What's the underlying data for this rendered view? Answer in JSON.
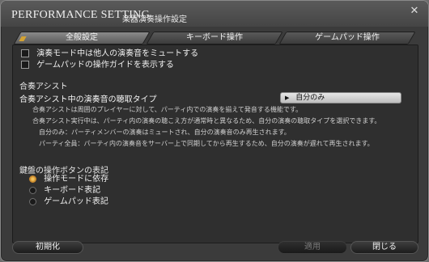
{
  "window": {
    "title": "PERFORMANCE SETTING",
    "subtitle": "楽器演奏操作設定",
    "close_icon": "close-icon"
  },
  "tabs": [
    {
      "label": "全般設定",
      "active": true
    },
    {
      "label": "キーボード操作",
      "active": false
    },
    {
      "label": "ゲームパッド操作",
      "active": false
    }
  ],
  "checkboxes": [
    {
      "label": "演奏モード中は他人の演奏音をミュートする",
      "checked": false
    },
    {
      "label": "ゲームパッドの操作ガイドを表示する",
      "checked": false
    }
  ],
  "ensemble": {
    "section_title": "合奏アシスト",
    "setting_label": "合奏アシスト中の演奏音の聴取タイプ",
    "dropdown_value": "自分のみ",
    "descriptions": [
      "合奏アシストは周囲のプレイヤーに対して、パーティ内での演奏を揃えて発音する機能です。",
      "合奏アシスト実行中は、パーティ内の演奏の聴こえ方が通常時と異なるため、自分の演奏の聴取タイプを選択できます。",
      "自分のみ：パーティメンバーの演奏はミュートされ、自分の演奏音のみ再生されます。",
      "パーティ全員：パーティ内の演奏音をサーバー上で同期してから再生するため、自分の演奏が遅れて再生されます。"
    ]
  },
  "keyboard_binding": {
    "section_title": "鍵盤の操作ボタンの表記",
    "options": [
      {
        "label": "操作モードに依存",
        "selected": true
      },
      {
        "label": "キーボード表記",
        "selected": false
      },
      {
        "label": "ゲームパッド表記",
        "selected": false
      }
    ]
  },
  "buttons": {
    "reset": "初期化",
    "apply": "適用",
    "close": "閉じる"
  },
  "colors": {
    "accent": "#d3a233",
    "panel_bg": "#2f2f2f",
    "window_bg": "#3b3b3b"
  }
}
